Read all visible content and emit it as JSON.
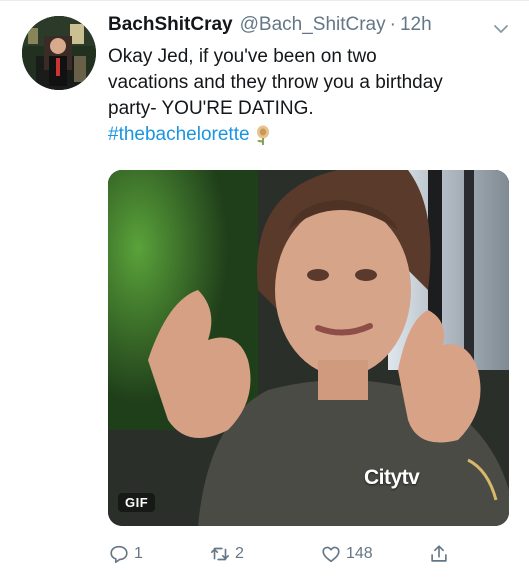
{
  "tweet": {
    "display_name": "BachShitCray",
    "handle": "@Bach_ShitCray",
    "separator": "·",
    "time": "12h",
    "text_line1": "Okay Jed, if you've been on two",
    "text_line2": "vacations and they throw you a birthday",
    "text_line3": "party- YOU'RE DATING.",
    "hashtag": "#thebachelorette",
    "media": {
      "badge": "GIF",
      "watermark": "Citytv"
    },
    "actions": {
      "replies": "1",
      "retweets": "2",
      "likes": "148"
    }
  },
  "icons": {
    "reply": "reply-icon",
    "retweet": "retweet-icon",
    "like": "heart-icon",
    "share": "share-icon",
    "menu": "chevron-down-icon",
    "emoji": "rose-emoji-icon"
  },
  "colors": {
    "text": "#14171a",
    "secondary": "#657786",
    "link": "#1b95e0",
    "divider": "#e6ecf0"
  }
}
